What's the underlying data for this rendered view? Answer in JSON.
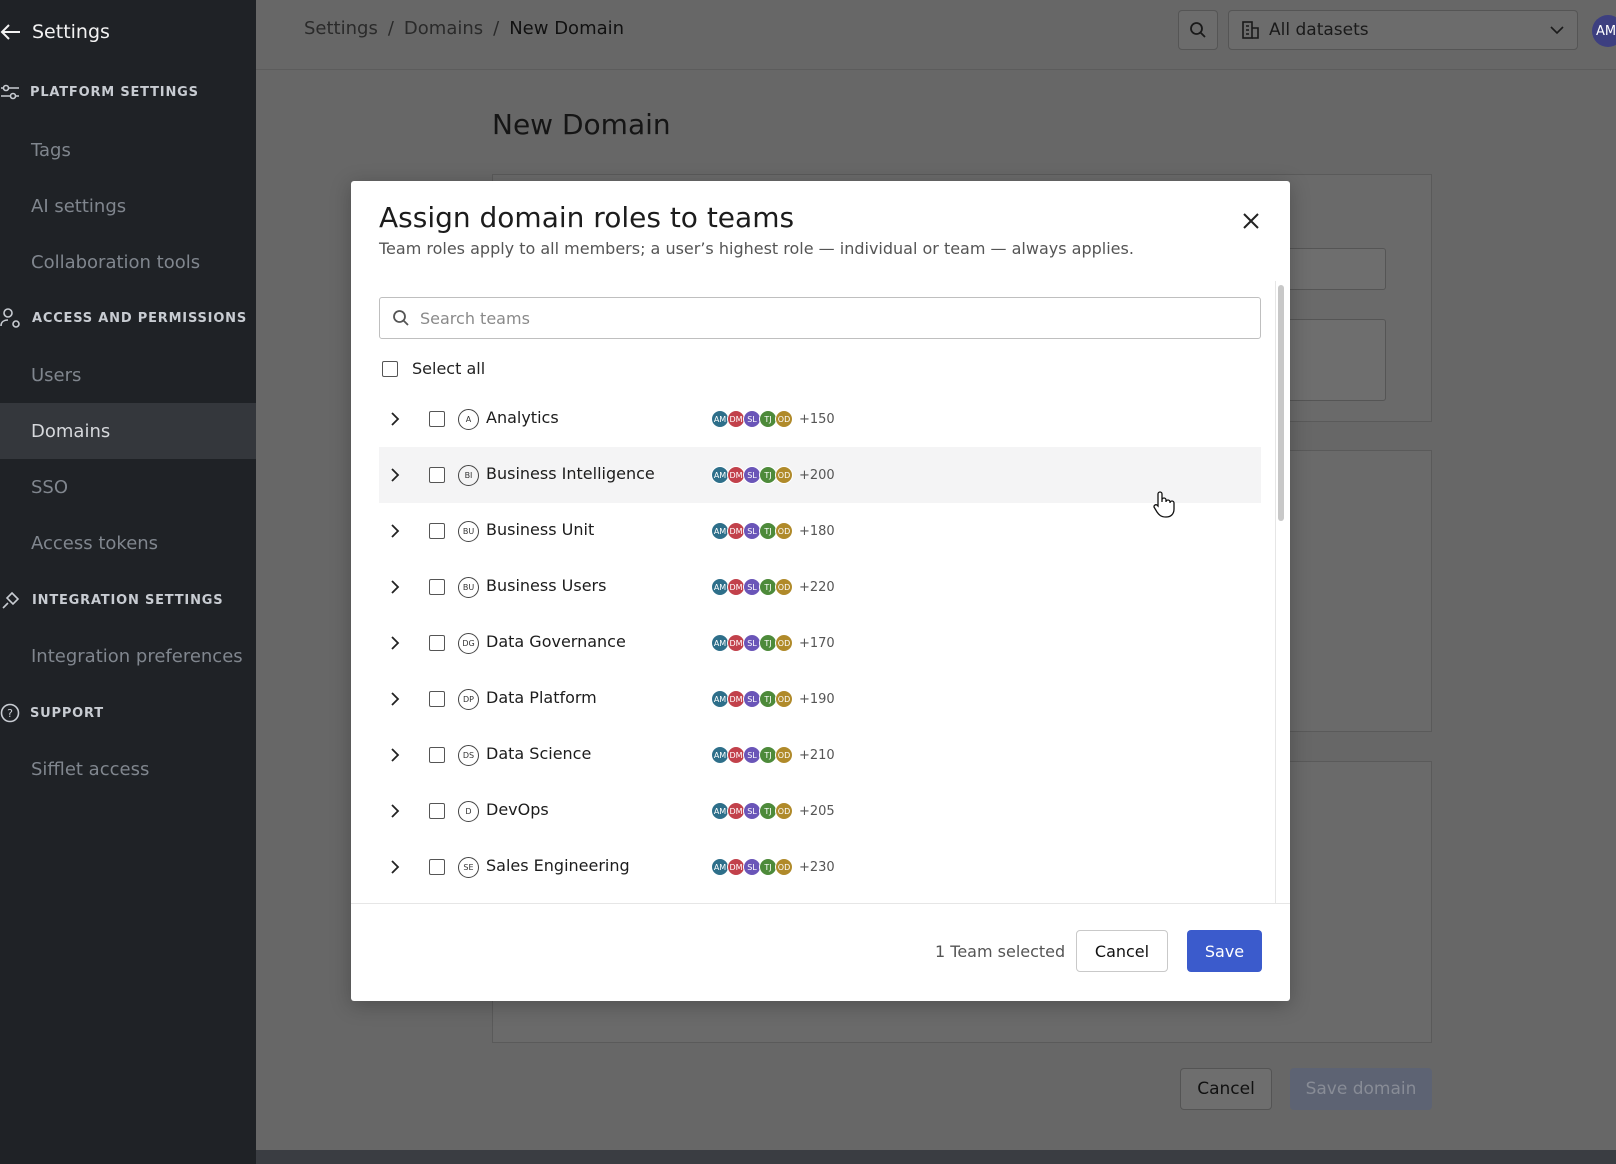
{
  "sidebar": {
    "back_label": "Settings",
    "sections": [
      {
        "title": "PLATFORM SETTINGS",
        "items": [
          "Tags",
          "AI settings",
          "Collaboration tools"
        ]
      },
      {
        "title": "ACCESS AND PERMISSIONS",
        "items": [
          "Users",
          "Domains",
          "SSO",
          "Access tokens"
        ]
      },
      {
        "title": "INTEGRATION SETTINGS",
        "items": [
          "Integration preferences"
        ]
      },
      {
        "title": "SUPPORT",
        "items": [
          "Sifflet access"
        ]
      }
    ],
    "active_item": "Domains"
  },
  "header": {
    "breadcrumb": [
      "Settings",
      "Domains",
      "New Domain"
    ],
    "dataset_select": "All datasets",
    "avatar_initials": "AM"
  },
  "page": {
    "title": "New Domain",
    "cancel_label": "Cancel",
    "save_label": "Save domain"
  },
  "modal": {
    "title": "Assign domain roles to teams",
    "subtitle": "Team roles apply to all members; a user’s highest role — individual or team — always applies.",
    "search_placeholder": "Search teams",
    "select_all_label": "Select all",
    "avatar_initials": [
      "AM",
      "DM",
      "SL",
      "TJ",
      "OD"
    ],
    "avatar_colors": [
      "#2e6f8a",
      "#c2414b",
      "#6a55b8",
      "#4d8a3a",
      "#b08a2a"
    ],
    "teams": [
      {
        "icon": "A",
        "name": "Analytics",
        "count": "+150"
      },
      {
        "icon": "BI",
        "name": "Business Intelligence",
        "count": "+200"
      },
      {
        "icon": "BU",
        "name": "Business Unit",
        "count": "+180"
      },
      {
        "icon": "BU",
        "name": "Business Users",
        "count": "+220"
      },
      {
        "icon": "DG",
        "name": "Data Governance",
        "count": "+170"
      },
      {
        "icon": "DP",
        "name": "Data Platform",
        "count": "+190"
      },
      {
        "icon": "DS",
        "name": "Data Science",
        "count": "+210"
      },
      {
        "icon": "D",
        "name": "DevOps",
        "count": "+205"
      },
      {
        "icon": "SE",
        "name": "Sales Engineering",
        "count": "+230"
      }
    ],
    "selected_count_label": "1 Team selected",
    "cancel_label": "Cancel",
    "save_label": "Save"
  },
  "colors": {
    "sidebar_bg": "#1f2226",
    "overlay_bg": "#676767",
    "primary": "#3b5bcc"
  }
}
